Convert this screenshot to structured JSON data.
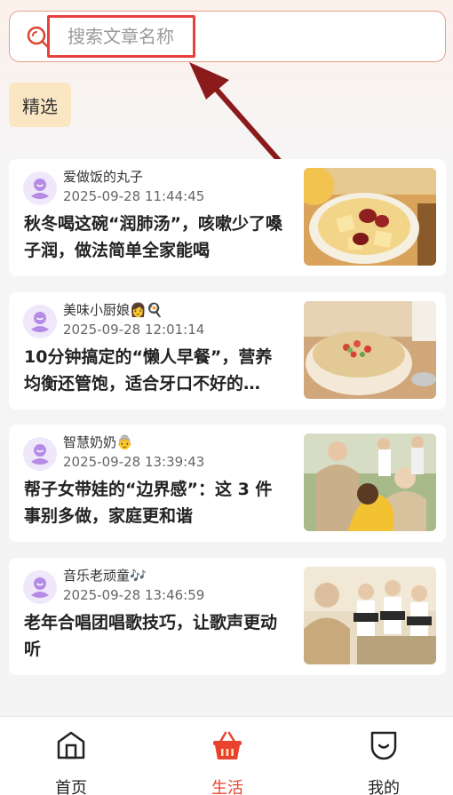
{
  "search": {
    "placeholder": "搜索文章名称"
  },
  "tabs": [
    {
      "label": "精选",
      "selected": true
    }
  ],
  "articles": [
    {
      "author": "爱做饭的丸子",
      "time": "2025-09-28 11:44:45",
      "title": "秋冬喝这碗“润肺汤”，咳嗽少了嗓子润，做法简单全家能喝",
      "thumbnail": "pear-soup-image"
    },
    {
      "author": "美味小厨娘👩🍳",
      "time": "2025-09-28 12:01:14",
      "title": "10分钟搞定的“懒人早餐”，营养均衡还管饱，适合牙口不好的…",
      "thumbnail": "oatmeal-bowl-image"
    },
    {
      "author": "智慧奶奶👵",
      "time": "2025-09-28 13:39:43",
      "title": "帮子女带娃的“边界感”：这 3 件事别多做，家庭更和谐",
      "thumbnail": "grandparents-child-image"
    },
    {
      "author": "音乐老顽童🎶",
      "time": "2025-09-28 13:46:59",
      "title": "老年合唱团唱歌技巧，让歌声更动听",
      "thumbnail": "choir-image"
    }
  ],
  "bottom_nav": [
    {
      "label": "首页",
      "icon": "home-icon",
      "active": false
    },
    {
      "label": "生活",
      "icon": "basket-icon",
      "active": true
    },
    {
      "label": "我的",
      "icon": "profile-face-icon",
      "active": false
    }
  ],
  "colors": {
    "accent": "#e8442d",
    "highlight_box": "#e8403c",
    "arrow": "#8b1a1a",
    "chip_bg": "#fbe6c3"
  }
}
